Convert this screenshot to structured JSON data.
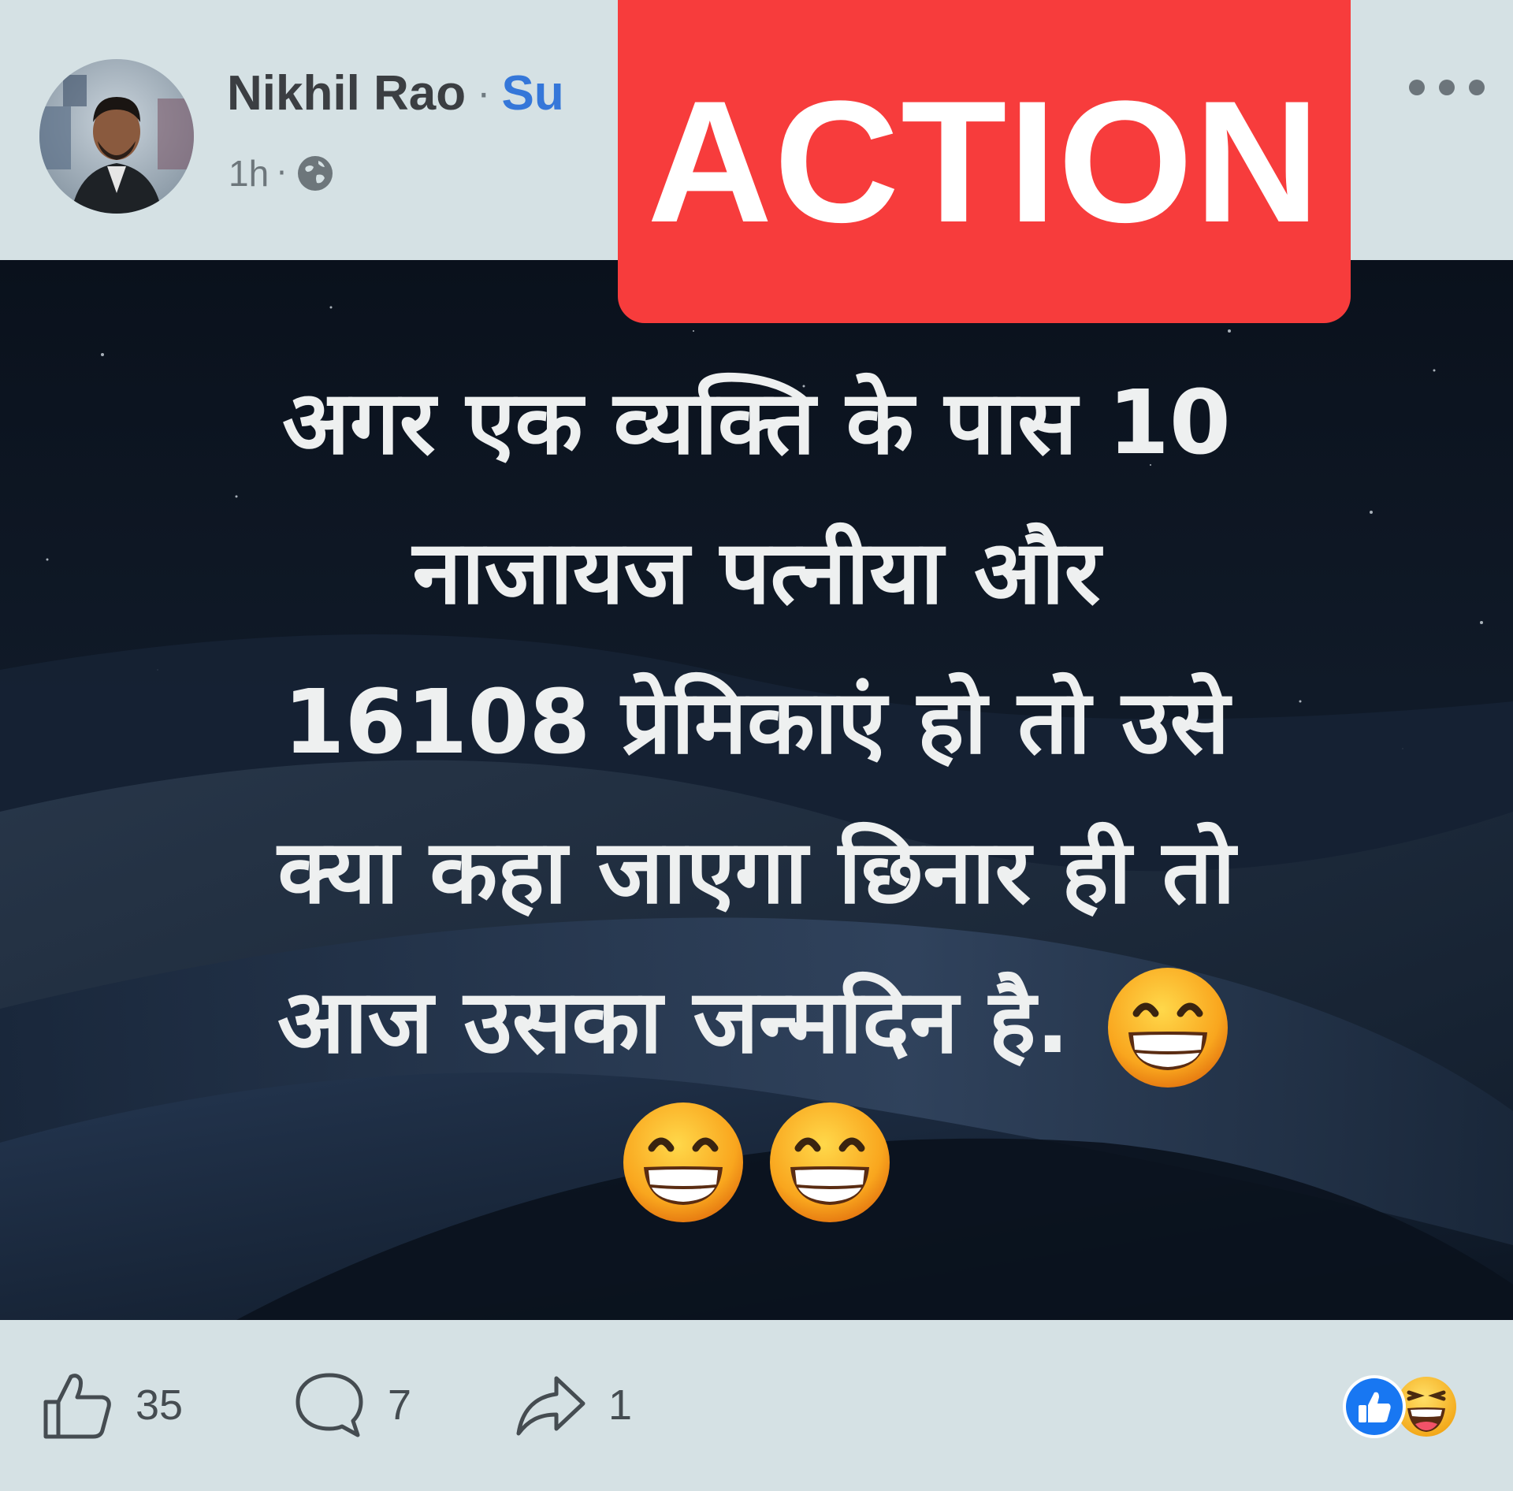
{
  "header": {
    "author_name": "Nikhil Rao",
    "separator": "·",
    "follow_label": "Su",
    "time": "1h",
    "time_separator": "·",
    "privacy_icon": "globe-icon",
    "menu_icon": "more-horizontal-icon"
  },
  "overlay": {
    "label": "ACTION",
    "color": "#f73c3c"
  },
  "post": {
    "lines": [
      "अगर एक व्यक्ति के पास 10",
      "नाजायज पत्नीया और",
      "16108 प्रेमिकाएं हो तो उसे",
      "क्या कहा जाएगा छिनार ही तो",
      "आज उसका जन्मदिन है."
    ],
    "emoji_name": "grinning-face-icon",
    "background": "night-sky-dunes"
  },
  "footer": {
    "like_count": "35",
    "comment_count": "7",
    "share_count": "1",
    "reaction_icons": [
      "like-reaction-icon",
      "haha-reaction-icon"
    ],
    "accent_color": "#1877f2"
  }
}
